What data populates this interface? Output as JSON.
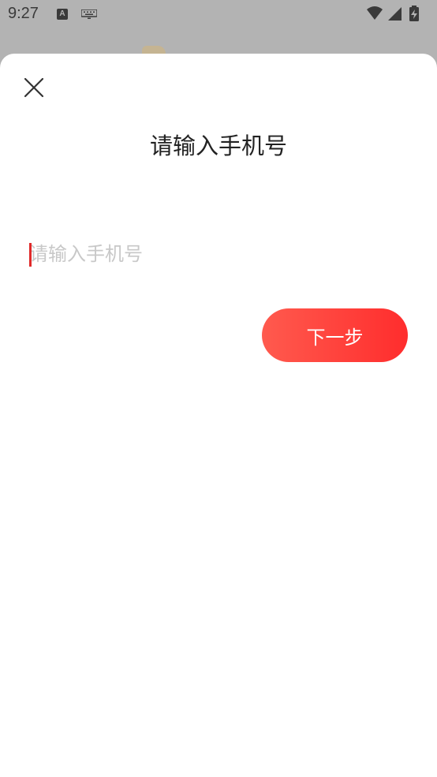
{
  "status_bar": {
    "time": "9:27",
    "notification_icons": [
      "a-icon",
      "keyboard-icon"
    ],
    "system_icons": [
      "wifi-icon",
      "signal-icon",
      "battery-charging-icon"
    ]
  },
  "dialog": {
    "title": "请输入手机号",
    "phone_input": {
      "value": "",
      "placeholder": "请输入手机号"
    },
    "next_button_label": "下一步",
    "close_icon": "close-icon"
  },
  "colors": {
    "accent_start": "#ff5a4e",
    "accent_end": "#ff2d2d",
    "overlay": "#b3b3b3",
    "placeholder": "#c8c8c8",
    "title_text": "#222222"
  }
}
